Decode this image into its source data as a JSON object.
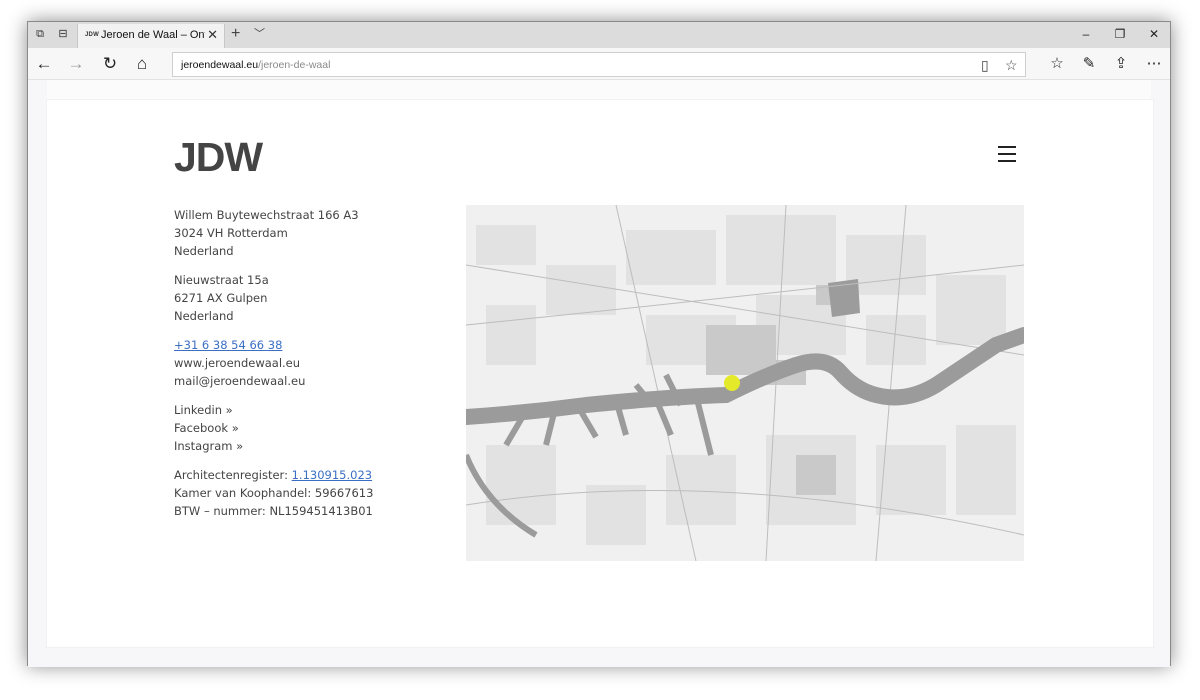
{
  "browser": {
    "tab": {
      "favicon_text": "JDW",
      "title": "Jeroen de Waal – Ontwerp"
    },
    "url_host": "jeroendewaal.eu",
    "url_path": "/jeroen-de-waal"
  },
  "site": {
    "logo": "JDW",
    "address1": [
      "Willem Buytewechstraat 166 A3",
      "3024 VH Rotterdam",
      "Nederland"
    ],
    "address2": [
      "Nieuwstraat 15a",
      "6271 AX Gulpen",
      "Nederland"
    ],
    "contact": {
      "phone": "+31 6 38 54 66 38",
      "web": "www.jeroendewaal.eu",
      "email": "mail@jeroendewaal.eu"
    },
    "social": [
      "Linkedin »",
      "Facebook »",
      "Instagram »"
    ],
    "registry": {
      "architect_label": "Architectenregister: ",
      "architect_number": "1.130915.023",
      "kvk": "Kamer van Koophandel: 59667613",
      "btw": "BTW – nummer: NL159451413B01"
    }
  },
  "colors": {
    "map_marker": "#e4ea2a",
    "link": "#3b6fc4",
    "water": "#9b9b9b"
  }
}
